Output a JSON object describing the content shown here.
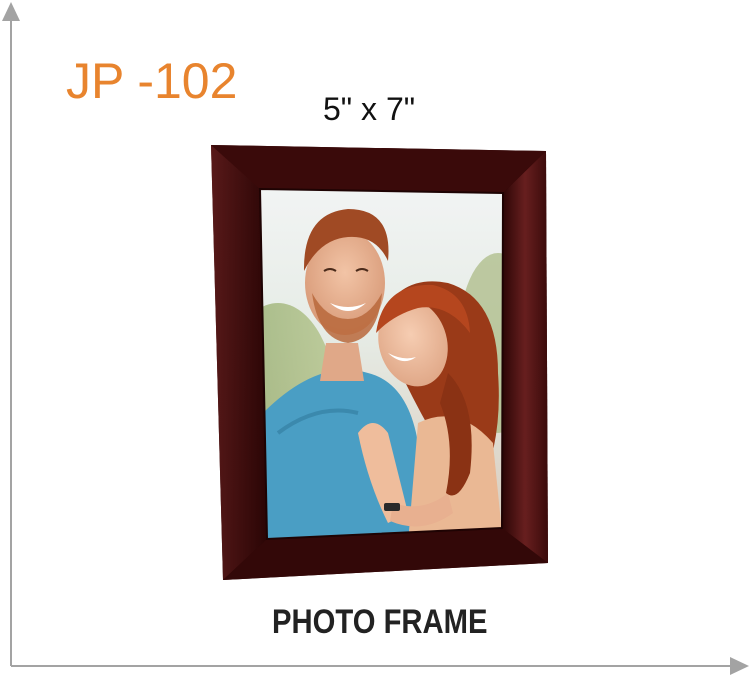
{
  "product": {
    "code": "JP -102",
    "size": "5\" x 7\"",
    "name": "PHOTO FRAME"
  },
  "colors": {
    "code_accent": "#e8842e",
    "frame_wood": "#3a0c0c",
    "axis": "#a0a0a0"
  },
  "icons": {
    "frame": "photo-frame-illustration",
    "axis_up": "arrow-up-icon",
    "axis_right": "arrow-right-icon"
  }
}
